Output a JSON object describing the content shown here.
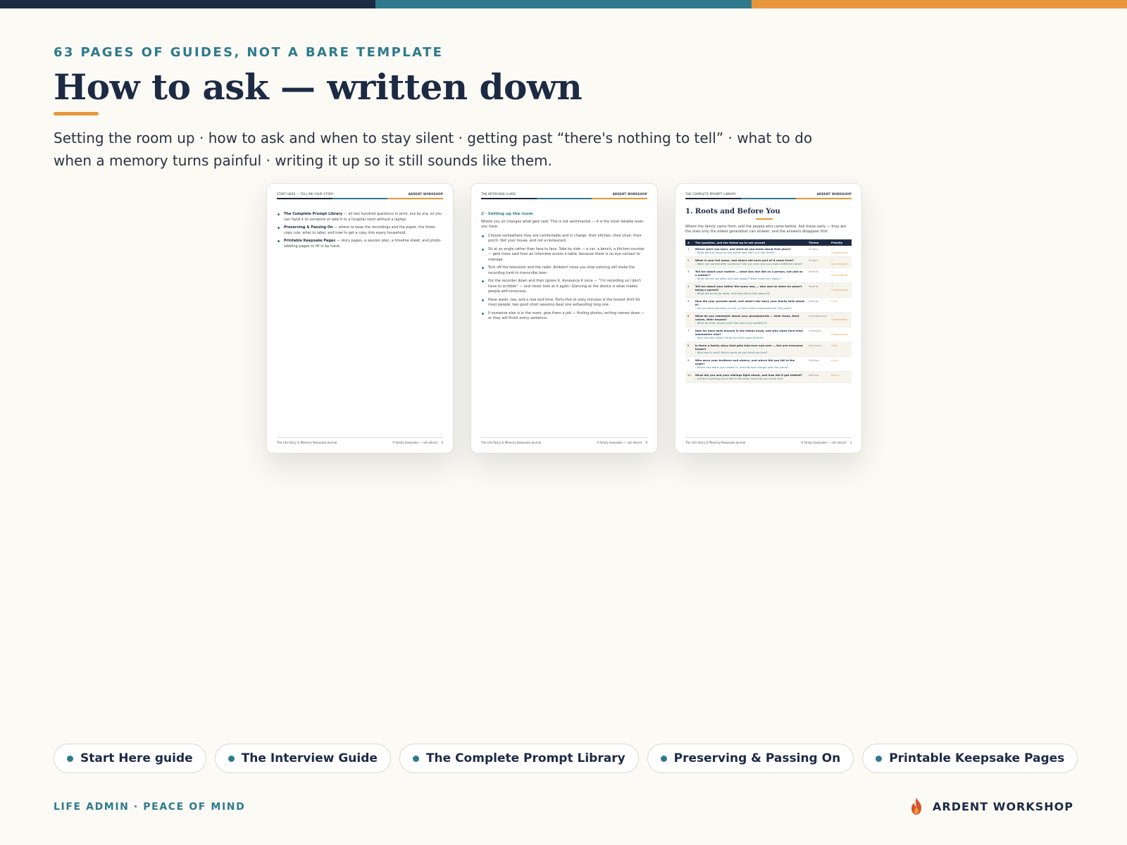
{
  "colors": {
    "navy": "#1d2a44",
    "teal": "#2e7a8c",
    "orange": "#e8963b"
  },
  "eyebrow": "63 PAGES OF GUIDES, NOT A BARE TEMPLATE",
  "title": "How to ask — written down",
  "intro": "Setting the room up · how to ask and when to stay silent · getting past “there's nothing to tell” · what to do when a memory turns painful · writing it up so it still sounds like them.",
  "pages": [
    {
      "header_left": "START HERE — TELL ME YOUR STORY",
      "header_right": "ARDENT WORKSHOP",
      "bullets": [
        {
          "strong": "The Complete Prompt Library",
          "text": " — all two hundred questions in print, era by era, so you can hand it to someone or take it to a hospital room without a laptop."
        },
        {
          "strong": "Preserving & Passing On",
          "text": " — where to keep the recordings and the paper, the three-copy rule, what to label, and how to get a copy into every household."
        },
        {
          "strong": "Printable Keepsake Pages",
          "text": " — story pages, a session plan, a timeline sheet, and photo-labeling pages to fill in by hand."
        }
      ],
      "footer_left": "The Life-Story & Memory Keepsake Journal",
      "footer_right": "A family keepsake — not advice.",
      "page_no": "4"
    },
    {
      "header_left": "THE INTERVIEW GUIDE",
      "header_right": "ARDENT WORKSHOP",
      "section": "2 · Setting up the room",
      "lead": "Where you sit changes what gets said. This is not sentimental — it is the most reliable lever you have.",
      "bullets": [
        "Choose somewhere they are comfortable and in charge: their kitchen, their chair, their porch. Not your house, and not a restaurant.",
        "Sit at an angle rather than face to face. Side by side — a car, a bench, a kitchen counter — gets more said than an interview across a table, because there is no eye contact to manage.",
        "Turn off the television and the radio. Ambient noise you stop noticing will make the recording hard to transcribe later.",
        "Put the recorder down and then ignore it. Announce it once — “I'm recording so I don't have to scribble” — and never look at it again. Glancing at the device is what makes people self-conscious.",
        "Have water, tea, and a real end time. Forty-five to sixty minutes is the honest limit for most people; two good short sessions beat one exhausting long one.",
        "If someone else is in the room, give them a job — finding photos, writing names down — or they will finish every sentence."
      ],
      "footer_left": "The Life-Story & Memory Keepsake Journal",
      "footer_right": "A family keepsake — not advice.",
      "page_no": "9"
    },
    {
      "header_left": "THE COMPLETE PROMPT LIBRARY",
      "header_right": "ARDENT WORKSHOP",
      "title": "1. Roots and Before You",
      "lead": "Where the family came from, and the people who came before. Ask these early — they are the ones only the oldest generation can answer, and the answers disappear first.",
      "table_headers": [
        "#",
        "The question, and the follow-up to ask second",
        "Theme",
        "Priority"
      ],
      "rows": [
        {
          "n": "1",
          "q": "Where were you born, and what do you know about that place?",
          "f": "› What did the house or the street look like? Is it still there?",
          "theme": "Origins",
          "priority": "• Cornerstone"
        },
        {
          "n": "2",
          "q": "What is your full name, and where did each part of it come from?",
          "f": "› Were you named after someone? Did you ever wish you had a different name?",
          "theme": "Origins",
          "priority": "• Cornerstone"
        },
        {
          "n": "3",
          "q": "Tell me about your mother — what was she like as a person, not just as a mother?",
          "f": "› What did she do when she was happy? What made her angry?",
          "theme": "Parents",
          "priority": "• Cornerstone"
        },
        {
          "n": "4",
          "q": "Tell me about your father the same way — who was he when he wasn't being a parent?",
          "f": "› What did he do for work, and how did he feel about it?",
          "theme": "Parents",
          "priority": "• Cornerstone"
        },
        {
          "n": "5",
          "q": "How did your parents meet, and what's the story your family tells about it?",
          "f": "› Do you think the story is true, or has it been improved over the years?",
          "theme": "Parents",
          "priority": "Core"
        },
        {
          "n": "6",
          "q": "What do you remember about your grandparents — their faces, their voices, their houses?",
          "f": "› What did their house smell like when you walked in?",
          "theme": "Grandparents",
          "priority": "• Cornerstone"
        },
        {
          "n": "7",
          "q": "How far back does anyone in the family know, and who came here from somewhere else?",
          "f": "› Why did they leave? What did they leave behind?",
          "theme": "Ancestors",
          "priority": "• Cornerstone"
        },
        {
          "n": "8",
          "q": "Is there a family story that gets told over and over — the one everyone knows?",
          "f": "› Who tells it best? Which parts do you think are true?",
          "theme": "Ancestors",
          "priority": "Core"
        },
        {
          "n": "9",
          "q": "Who were your brothers and sisters, and where did you fall in the order?",
          "f": "› Which one were you closest to, and did that change over the years?",
          "theme": "Siblings",
          "priority": "Core"
        },
        {
          "n": "10",
          "q": "What did you and your siblings fight about, and how did it get settled?",
          "f": "› Is there anything you'd like to tell them now that you never did?",
          "theme": "Siblings",
          "priority": "Bonus"
        }
      ],
      "footer_left": "The Life-Story & Memory Keepsake Journal",
      "footer_right": "A family keepsake — not advice.",
      "page_no": "3"
    }
  ],
  "chips": [
    "Start Here guide",
    "The Interview Guide",
    "The Complete Prompt Library",
    "Preserving & Passing On",
    "Printable Keepsake Pages"
  ],
  "footer": {
    "left": "LIFE ADMIN · PEACE OF MIND",
    "brand": "ARDENT WORKSHOP",
    "brand_icon": "flame-icon"
  }
}
